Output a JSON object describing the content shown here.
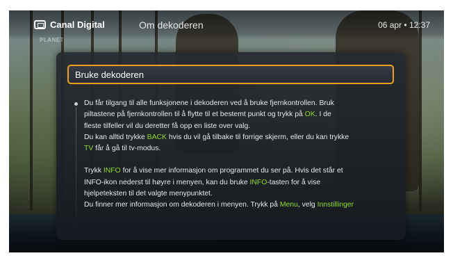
{
  "header": {
    "brand": "Canal Digital",
    "brand_icon": "tv-icon",
    "menu_title": "Om dekoderen",
    "datetime": "06 apr • 12:37",
    "channel_logo": "PLANET"
  },
  "dialog": {
    "title": "Bruke dekoderen",
    "highlight_color": "#f0a020",
    "keyword_color": "#8ddc22",
    "lines": [
      [
        {
          "t": "Du får tilgang til alle funksjonene i dekoderen ved å bruke fjernkontrollen. Bruk"
        }
      ],
      [
        {
          "t": "piltastene på fjernkontrollen til å flytte til et bestemt punkt og trykk på "
        },
        {
          "t": "OK",
          "k": true
        },
        {
          "t": ". I de"
        }
      ],
      [
        {
          "t": "fleste tilfeller vil du deretter få opp en liste over valg."
        }
      ],
      [
        {
          "t": "Du kan alltid trykke "
        },
        {
          "t": "BACK",
          "k": true
        },
        {
          "t": " hvis du vil gå tilbake til forrige skjerm, eller du kan trykke"
        }
      ],
      [
        {
          "t": "TV",
          "k": true
        },
        {
          "t": " får å gå til tv-modus."
        }
      ],
      [],
      [
        {
          "t": "Trykk "
        },
        {
          "t": "INFO",
          "k": true
        },
        {
          "t": " for å vise mer informasjon om programmet du ser på. Hvis det står et"
        }
      ],
      [
        {
          "t": "INFO-ikon nederst til høyre i menyen, kan du bruke "
        },
        {
          "t": "INFO",
          "k": true
        },
        {
          "t": "-tasten for å vise"
        }
      ],
      [
        {
          "t": "hjelpeteksten til det valgte menypunktet."
        }
      ],
      [
        {
          "t": "Du finner mer informasjon om dekoderen i menyen. Trykk på "
        },
        {
          "t": "Menu",
          "k": true
        },
        {
          "t": ", velg "
        },
        {
          "t": "Innstillinger",
          "k": true
        }
      ]
    ]
  }
}
